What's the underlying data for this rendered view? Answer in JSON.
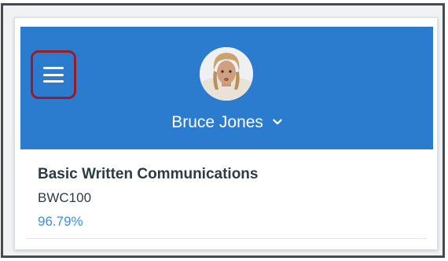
{
  "header": {
    "background_color": "#2b7bcf",
    "menu_icon": "hamburger-menu-icon",
    "menu_highlight_color": "#9b1c24",
    "user_name": "Bruce Jones",
    "user_menu_icon": "chevron-down-icon",
    "avatar": "user-avatar"
  },
  "course": {
    "title": "Basic Written Communications",
    "code": "BWC100",
    "grade": "96.79%",
    "grade_color": "#3d8fe0"
  }
}
